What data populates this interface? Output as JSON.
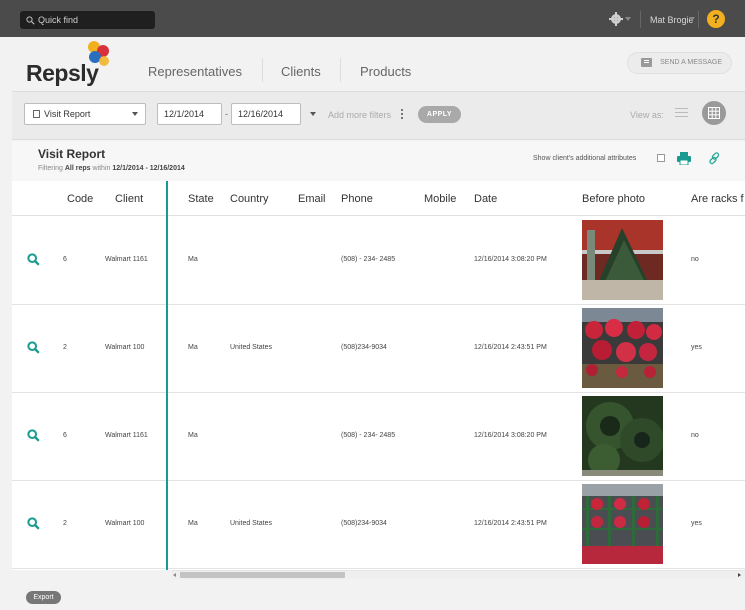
{
  "topbar": {
    "search_placeholder": "Quick find",
    "username": "Mat Brogie",
    "help_label": "?"
  },
  "header": {
    "logo": "Repsly",
    "nav": [
      "Representatives",
      "Clients",
      "Products"
    ],
    "send_message": "SEND A MESSAGE"
  },
  "filters": {
    "report_type": "Visit Report",
    "date_from": "12/1/2014",
    "date_to": "12/16/2014",
    "date_separator": "-",
    "add_filters": "Add more filters",
    "apply": "APPLY",
    "view_as": "View as:"
  },
  "report": {
    "title": "Visit Report",
    "filter_prefix": "Filtering",
    "filter_reps": "All reps",
    "filter_mid": "within",
    "filter_range": "12/1/2014 - 12/16/2014",
    "show_attrs": "Show client's additional attributes"
  },
  "table": {
    "columns": [
      "Code",
      "Client",
      "State",
      "Country",
      "Email",
      "Phone",
      "Mobile",
      "Date",
      "Before photo",
      "Are racks f"
    ],
    "rows": [
      {
        "code": "6",
        "client": "Walmart 1161",
        "state": "Ma",
        "country": "",
        "email": "",
        "phone": "(508) - 234- 2485",
        "mobile": "",
        "date": "12/16/2014 3:08:20 PM",
        "photo": "christmas-tree-photo",
        "racks": "no"
      },
      {
        "code": "2",
        "client": "Walmart 100",
        "state": "Ma",
        "country": "United States",
        "email": "",
        "phone": "(508)234-9034",
        "mobile": "",
        "date": "12/16/2014 2:43:51 PM",
        "photo": "poinsettia-photo",
        "racks": "yes"
      },
      {
        "code": "6",
        "client": "Walmart 1161",
        "state": "Ma",
        "country": "",
        "email": "",
        "phone": "(508) - 234- 2485",
        "mobile": "",
        "date": "12/16/2014 3:08:20 PM",
        "photo": "wreath-photo",
        "racks": "no"
      },
      {
        "code": "2",
        "client": "Walmart 100",
        "state": "Ma",
        "country": "United States",
        "email": "",
        "phone": "(508)234-9034",
        "mobile": "",
        "date": "12/16/2014 2:43:51 PM",
        "photo": "poinsettia-racks-photo",
        "racks": "yes"
      }
    ]
  },
  "footer": {
    "export": "Export"
  },
  "colors": {
    "accent": "#1a9b92",
    "topbar": "#4b4b4b",
    "help": "#f2b01e"
  }
}
